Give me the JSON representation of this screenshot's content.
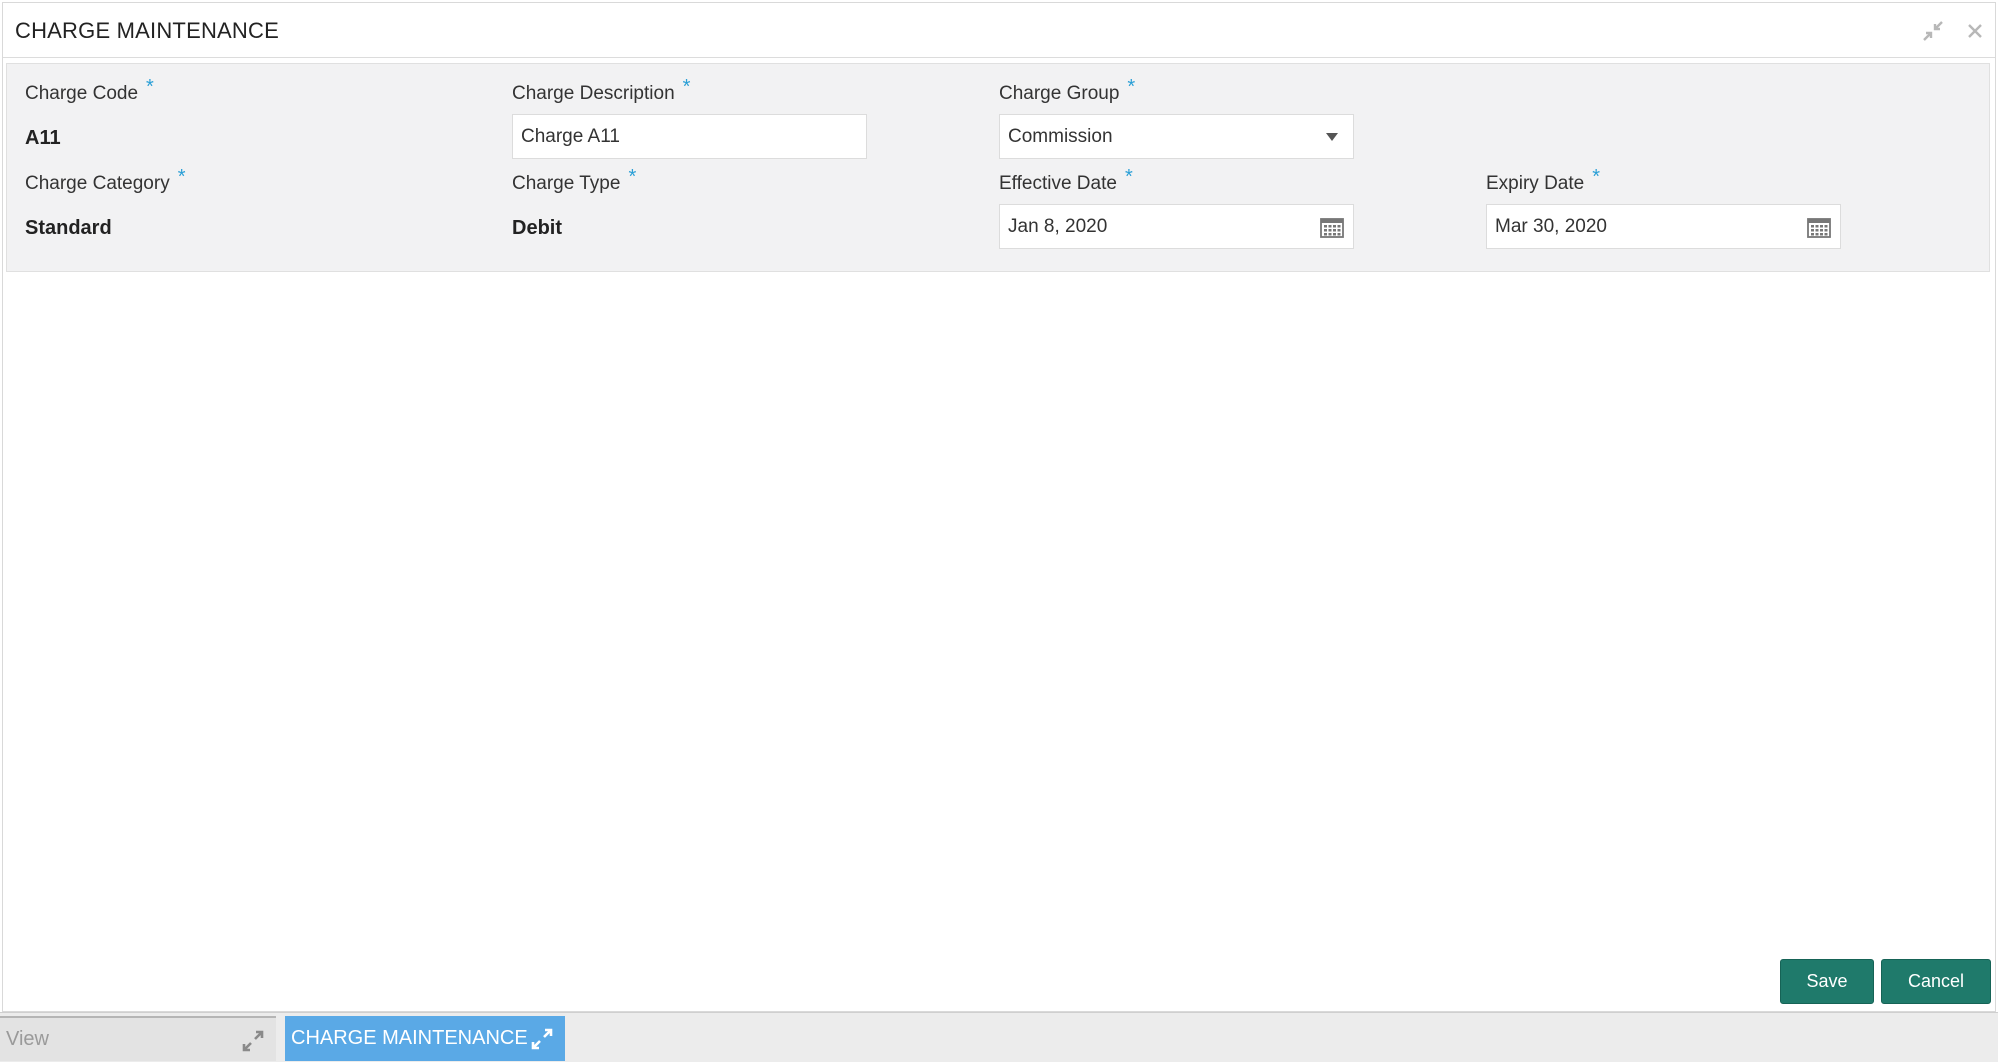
{
  "window": {
    "title": "CHARGE MAINTENANCE",
    "controls": {
      "minimize_icon": "minimize-arrows-icon",
      "close_icon": "close-icon"
    }
  },
  "form": {
    "charge_code": {
      "label": "Charge Code",
      "required": "*",
      "value": "A11"
    },
    "charge_description": {
      "label": "Charge Description",
      "required": "*",
      "value": "Charge A11"
    },
    "charge_group": {
      "label": "Charge Group",
      "required": "*",
      "value": "Commission"
    },
    "charge_category": {
      "label": "Charge Category",
      "required": "*",
      "value": "Standard"
    },
    "charge_type": {
      "label": "Charge Type",
      "required": "*",
      "value": "Debit"
    },
    "effective_date": {
      "label": "Effective Date",
      "required": "*",
      "value": "Jan 8, 2020"
    },
    "expiry_date": {
      "label": "Expiry Date",
      "required": "*",
      "value": "Mar 30, 2020"
    }
  },
  "actions": {
    "save_label": "Save",
    "cancel_label": "Cancel"
  },
  "taskbar": {
    "items": [
      {
        "label": "View",
        "active": false
      },
      {
        "label": "CHARGE MAINTENANCE",
        "active": true
      }
    ]
  },
  "colors": {
    "accent": "#1f7a6b",
    "required_marker": "#2a9fd6",
    "active_tab": "#5aa9e6"
  }
}
